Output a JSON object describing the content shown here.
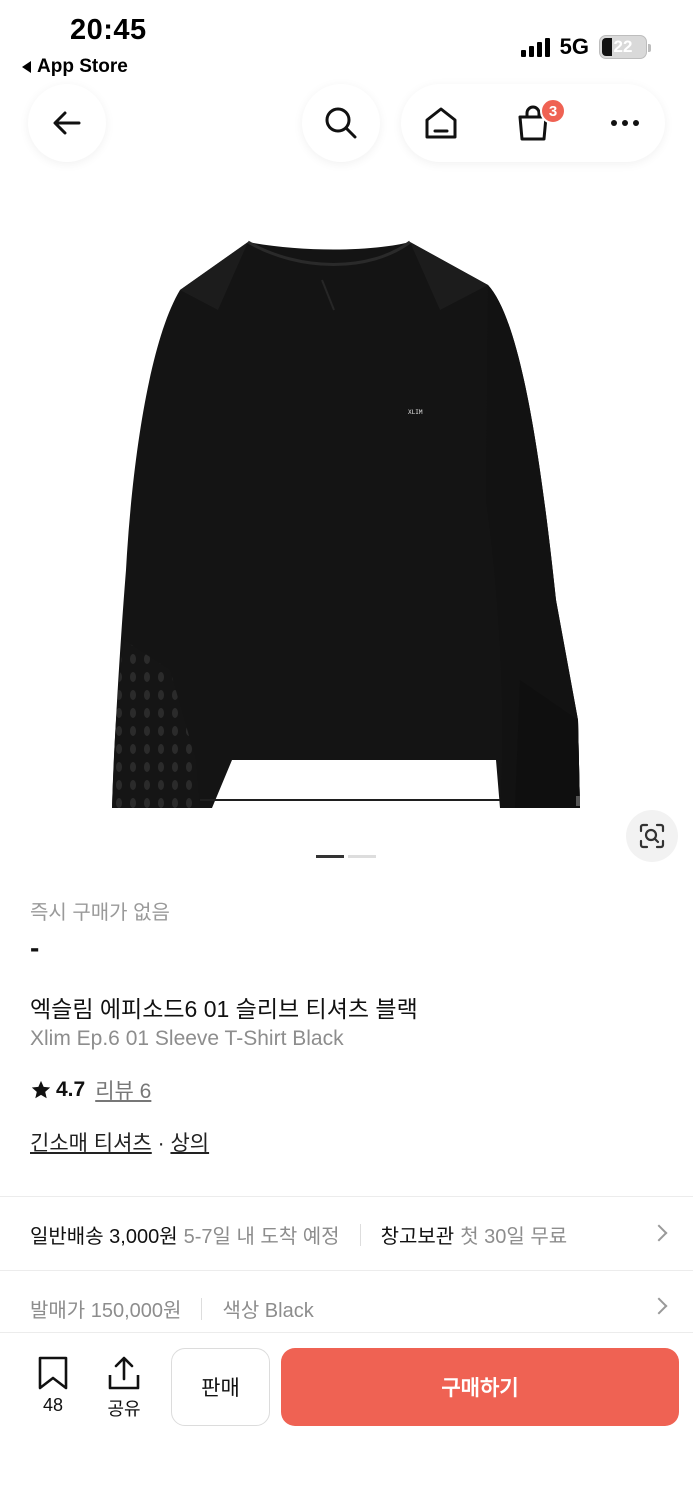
{
  "status_bar": {
    "time": "20:45",
    "back_app": "App Store",
    "network": "5G",
    "battery": "22"
  },
  "nav": {
    "cart_count": "3"
  },
  "product": {
    "logo_text": "XLIM",
    "pager": {
      "total": 2,
      "active": 1
    },
    "instant_purchase": "즉시 구매가 없음",
    "price": "-",
    "name_ko": "엑슬림 에피소드6 01 슬리브 티셔츠 블랙",
    "name_en": "Xlim Ep.6 01 Sleeve T-Shirt Black",
    "rating": "4.7",
    "reviews": "리뷰 6",
    "category_1": "긴소매 티셔츠",
    "category_sep": "·",
    "category_2": "상의"
  },
  "shipping": {
    "label": "일반배송 3,000원",
    "eta": "5-7일 내 도착 예정",
    "storage_label": "창고보관",
    "storage_note": "첫 30일 무료"
  },
  "meta": {
    "release_price": "발매가 150,000원",
    "color": "색상 Black"
  },
  "bottom_bar": {
    "wish_count": "48",
    "share_label": "공유",
    "sell_label": "판매",
    "buy_label": "구매하기"
  },
  "colors": {
    "accent": "#ef6253",
    "shirt": "#141414"
  }
}
